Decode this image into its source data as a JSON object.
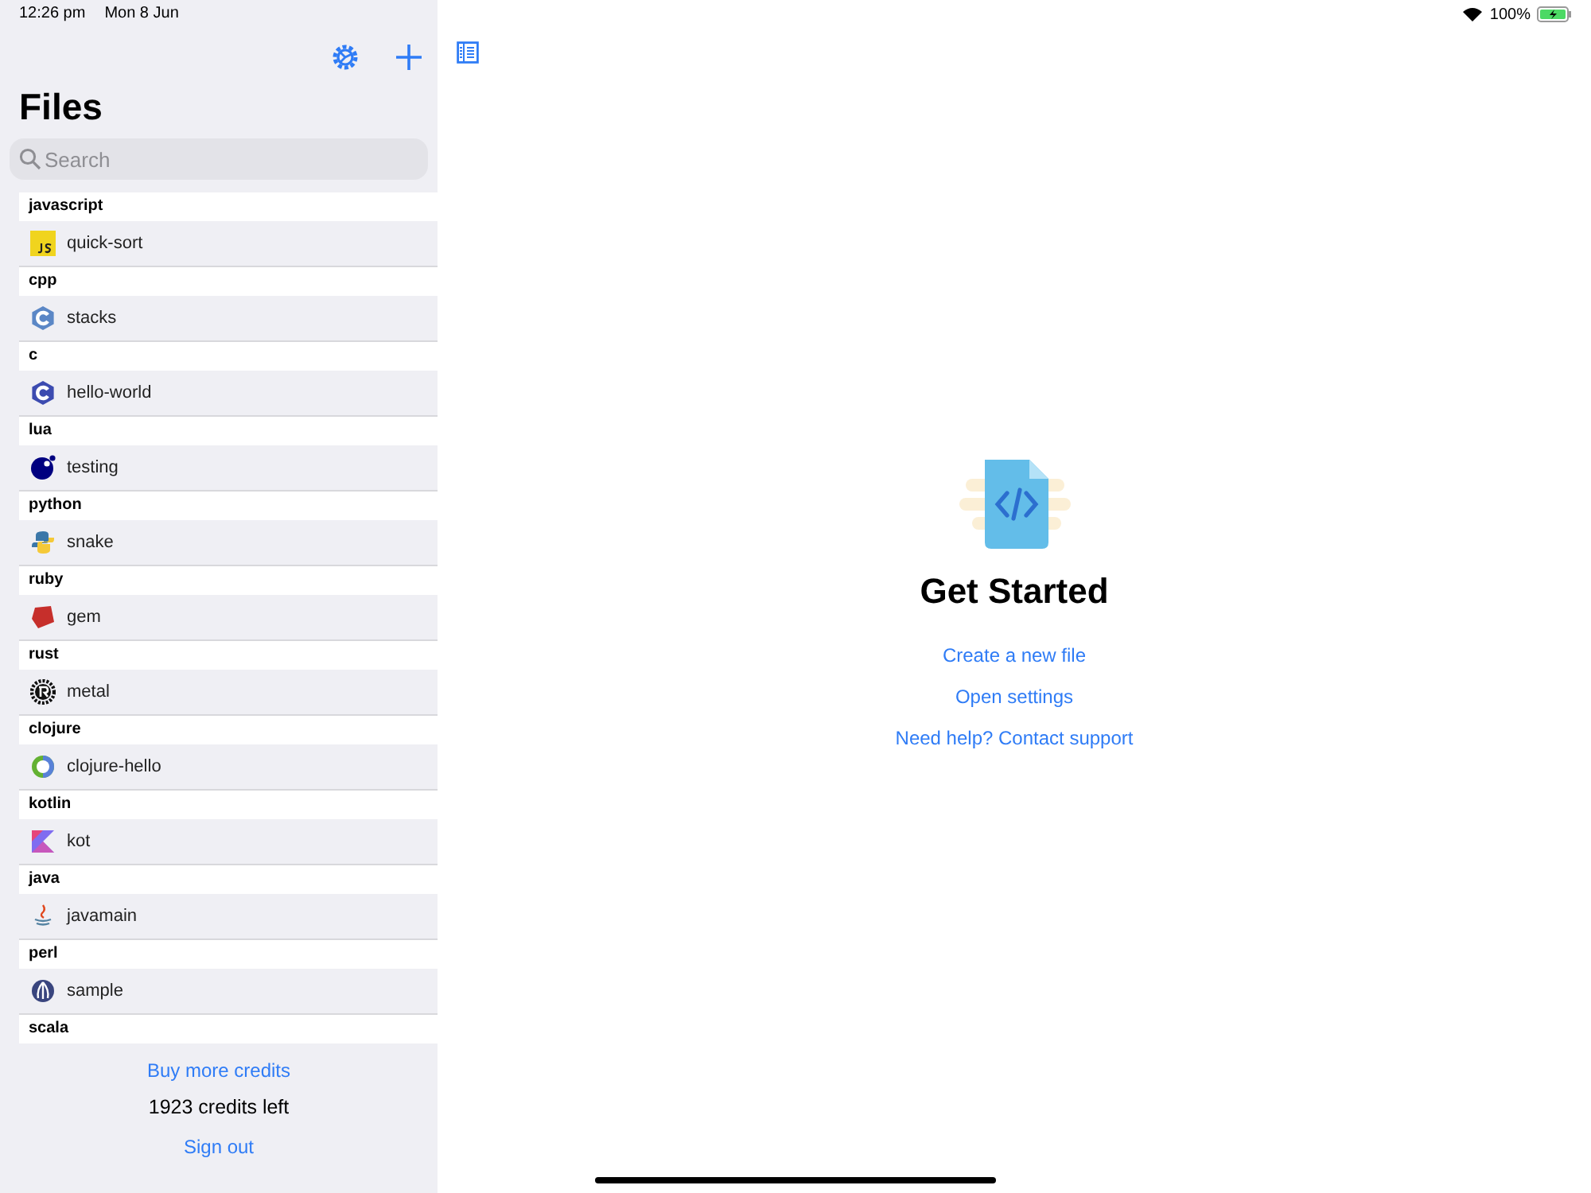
{
  "status_bar": {
    "time": "12:26 pm",
    "date": "Mon 8 Jun",
    "battery": "100%"
  },
  "sidebar": {
    "title": "Files",
    "search": {
      "placeholder": "Search"
    },
    "groups": [
      {
        "language": "javascript",
        "files": [
          {
            "name": "quick-sort",
            "kind": "js"
          }
        ]
      },
      {
        "language": "cpp",
        "files": [
          {
            "name": "stacks",
            "kind": "cpp"
          }
        ]
      },
      {
        "language": "c",
        "files": [
          {
            "name": "hello-world",
            "kind": "c"
          }
        ]
      },
      {
        "language": "lua",
        "files": [
          {
            "name": "testing",
            "kind": "lua"
          }
        ]
      },
      {
        "language": "python",
        "files": [
          {
            "name": "snake",
            "kind": "python"
          }
        ]
      },
      {
        "language": "ruby",
        "files": [
          {
            "name": "gem",
            "kind": "ruby"
          }
        ]
      },
      {
        "language": "rust",
        "files": [
          {
            "name": "metal",
            "kind": "rust"
          }
        ]
      },
      {
        "language": "clojure",
        "files": [
          {
            "name": "clojure-hello",
            "kind": "clojure"
          }
        ]
      },
      {
        "language": "kotlin",
        "files": [
          {
            "name": "kot",
            "kind": "kotlin"
          }
        ]
      },
      {
        "language": "java",
        "files": [
          {
            "name": "javamain",
            "kind": "java"
          }
        ]
      },
      {
        "language": "perl",
        "files": [
          {
            "name": "sample",
            "kind": "perl"
          }
        ]
      },
      {
        "language": "scala"
      }
    ],
    "buy_credits": "Buy more credits",
    "credits_left": "1923 credits left",
    "sign_out": "Sign out"
  },
  "main": {
    "title": "Get Started",
    "links": [
      "Create a new file",
      "Open settings",
      "Need help? Contact support"
    ]
  }
}
